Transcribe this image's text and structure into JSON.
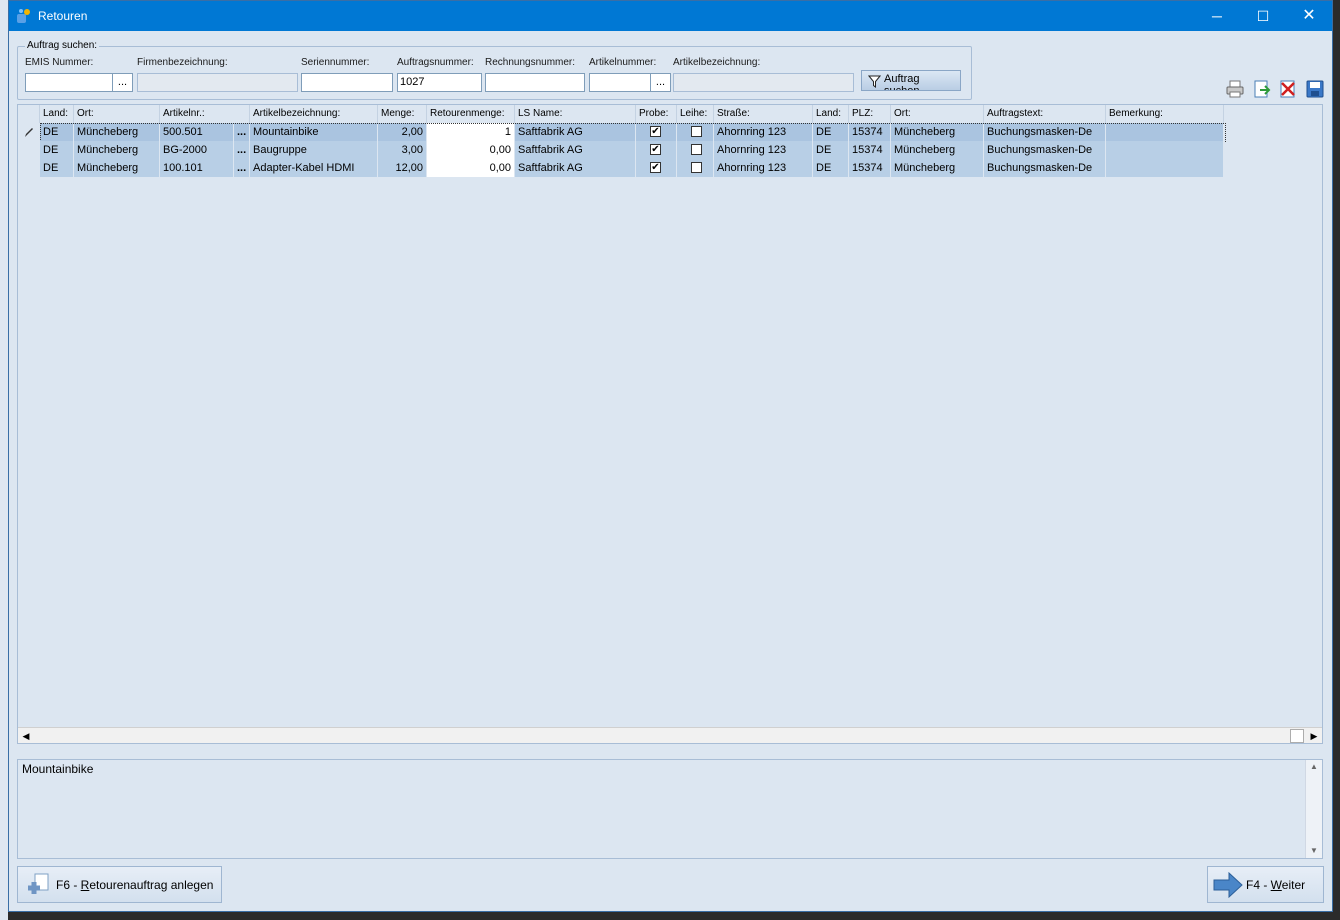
{
  "window": {
    "title": "Retouren"
  },
  "search": {
    "group_title": "Auftrag suchen:",
    "fields": [
      {
        "label": "EMIS Nummer:",
        "value": ""
      },
      {
        "label": "Firmenbezeichnung:",
        "value": ""
      },
      {
        "label": "Seriennummer:",
        "value": ""
      },
      {
        "label": "Auftragsnummer:",
        "value": "1027"
      },
      {
        "label": "Rechnungsnummer:",
        "value": ""
      },
      {
        "label": "Artikelnummer:",
        "value": ""
      },
      {
        "label": "Artikelbezeichnung:",
        "value": ""
      }
    ],
    "ellipsis": "...",
    "button_label": "Auftrag suchen"
  },
  "toolbar": {
    "icons": [
      "printer-icon",
      "export-icon",
      "delete-icon",
      "save-icon"
    ]
  },
  "grid": {
    "columns": [
      "Land:",
      "Ort:",
      "Artikelnr.:",
      "Artikelbezeichnung:",
      "Menge:",
      "Retourenmenge:",
      "LS Name:",
      "Probe:",
      "Leihe:",
      "Straße:",
      "Land:",
      "PLZ:",
      "Ort:",
      "Auftragstext:",
      "Bemerkung:"
    ],
    "rows": [
      {
        "land": "DE",
        "ort": "Müncheberg",
        "artikelnr": "500.501",
        "artikelbez": "Mountainbike",
        "menge": "2,00",
        "retourenmenge": "1",
        "ls_name": "Saftfabrik AG",
        "probe": true,
        "leihe": false,
        "strasse": "Ahornring 123",
        "land2": "DE",
        "plz": "15374",
        "ort2": "Müncheberg",
        "auftragstext": "Buchungsmasken-De",
        "bemerkung": ""
      },
      {
        "land": "DE",
        "ort": "Müncheberg",
        "artikelnr": "BG-2000",
        "artikelbez": "Baugruppe",
        "menge": "3,00",
        "retourenmenge": "0,00",
        "ls_name": "Saftfabrik AG",
        "probe": true,
        "leihe": false,
        "strasse": "Ahornring 123",
        "land2": "DE",
        "plz": "15374",
        "ort2": "Müncheberg",
        "auftragstext": "Buchungsmasken-De",
        "bemerkung": ""
      },
      {
        "land": "DE",
        "ort": "Müncheberg",
        "artikelnr": "100.101",
        "artikelbez": "Adapter-Kabel HDMI",
        "menge": "12,00",
        "retourenmenge": "0,00",
        "ls_name": "Saftfabrik AG",
        "probe": true,
        "leihe": false,
        "strasse": "Ahornring 123",
        "land2": "DE",
        "plz": "15374",
        "ort2": "Müncheberg",
        "auftragstext": "Buchungsmasken-De",
        "bemerkung": ""
      }
    ],
    "cell_ellipsis": "..."
  },
  "memo": {
    "text": "Mountainbike"
  },
  "buttons": {
    "create_prefix": "F6 - ",
    "create_key": "R",
    "create_rest": "etourenauftrag anlegen",
    "next_prefix": "F4 - ",
    "next_key": "W",
    "next_rest": "eiter"
  }
}
